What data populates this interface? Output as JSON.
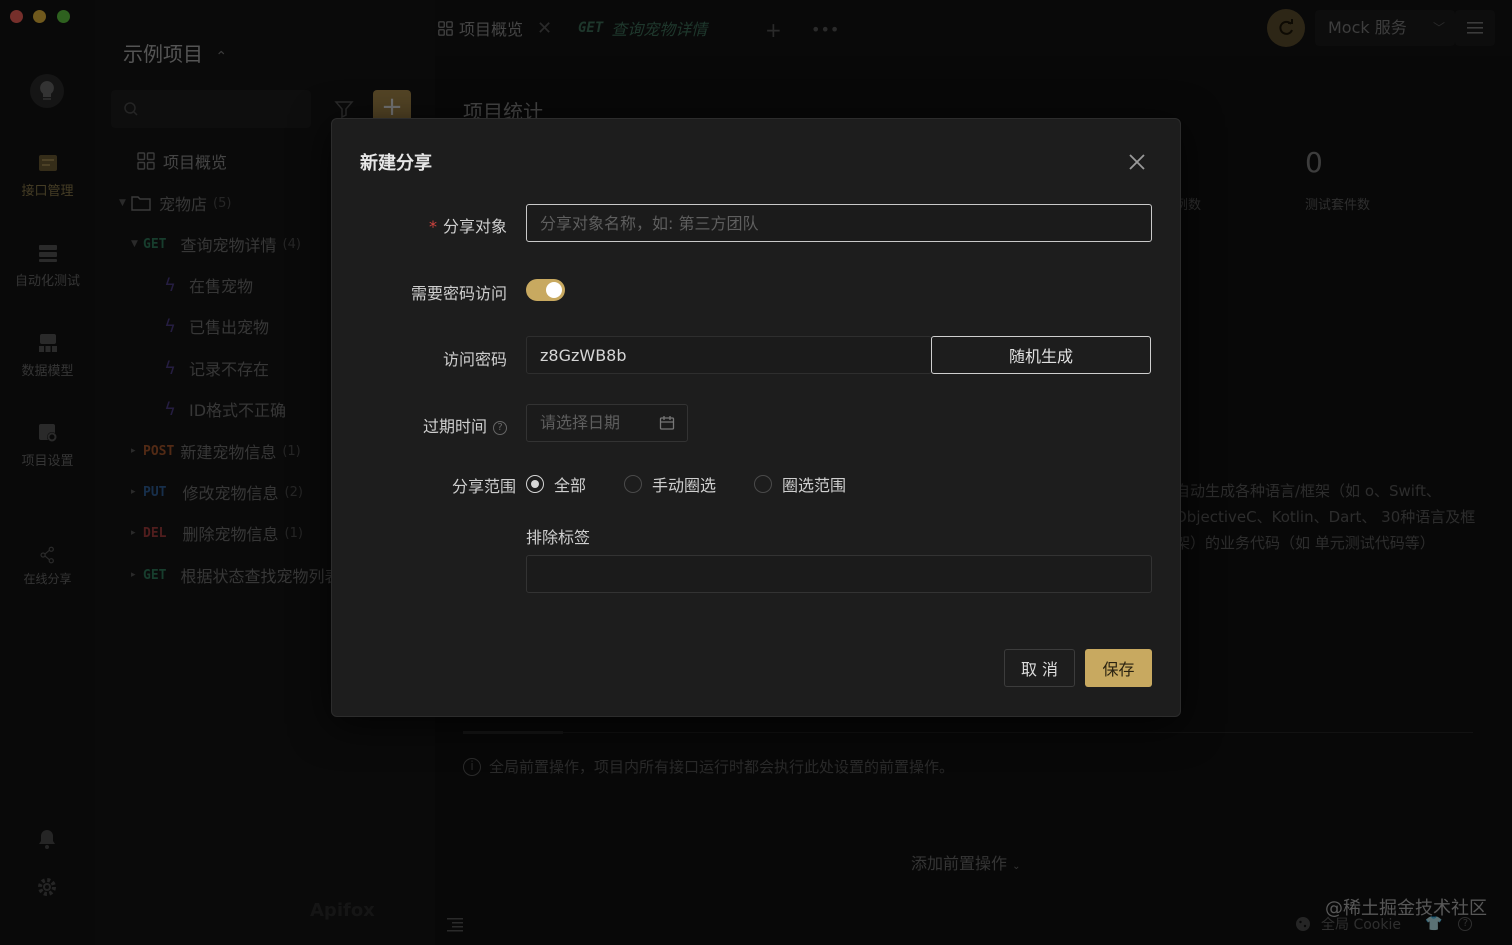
{
  "rail": {
    "items": [
      {
        "label": "接口管理",
        "icon": "api-management-icon"
      },
      {
        "label": "自动化测试",
        "icon": "automation-test-icon"
      },
      {
        "label": "数据模型",
        "icon": "data-model-icon"
      },
      {
        "label": "项目设置",
        "icon": "project-settings-icon"
      },
      {
        "label": "在线分享",
        "icon": "share-icon"
      }
    ]
  },
  "tree": {
    "project_title": "示例项目",
    "overview": "项目概览",
    "folder": {
      "name": "宠物店",
      "count": "(5)"
    },
    "endpoints": [
      {
        "method": "GET",
        "name": "查询宠物详情",
        "count": "(4)"
      },
      {
        "method": "POST",
        "name": "新建宠物信息",
        "count": "(1)"
      },
      {
        "method": "PUT",
        "name": "修改宠物信息",
        "count": "(2)"
      },
      {
        "method": "DEL",
        "name": "删除宠物信息",
        "count": "(1)"
      },
      {
        "method": "GET",
        "name": "根据状态查找宠物列表",
        "count": ""
      }
    ],
    "cases": [
      "在售宠物",
      "已售出宠物",
      "记录不存在",
      "ID格式不正确"
    ]
  },
  "topbar": {
    "tabs": [
      {
        "label": "项目概览"
      },
      {
        "method": "GET",
        "label": "查询宠物详情"
      }
    ],
    "mock_service": "Mock 服务"
  },
  "main": {
    "section_title": "项目统计",
    "stat_value": "0",
    "stat_label": "测试套件数",
    "stat_label_partial": "例数",
    "code_desc": "自动生成各种语言/框架（如 o、Swift、ObjectiveC、Kotlin、Dart、 30种语言及框架）的业务代码（如 单元测试代码等）",
    "pre_info": "全局前置操作，项目内所有接口运行时都会执行此处设置的前置操作。",
    "add_pre": "添加前置操作",
    "watermark": "@稀土掘金技术社区",
    "cookie": "全局 Cookie",
    "brand": "Apifox"
  },
  "modal": {
    "title": "新建分享",
    "share_target_label": "分享对象",
    "share_target_placeholder": "分享对象名称，如: 第三方团队",
    "need_password_label": "需要密码访问",
    "password_required": true,
    "password_label": "访问密码",
    "password_value": "z8GzWB8b",
    "random_generate": "随机生成",
    "expire_label": "过期时间",
    "date_placeholder": "请选择日期",
    "scope_label": "分享范围",
    "scope_options": [
      "全部",
      "手动圈选",
      "圈选范围"
    ],
    "scope_selected": "全部",
    "exclude_tags_label": "排除标签",
    "cancel": "取 消",
    "save": "保存"
  },
  "colors": {
    "accent": "#c8a960",
    "get": "#2f7a5a",
    "post": "#a5552a",
    "put": "#2f5e96",
    "del": "#a03b3b"
  }
}
